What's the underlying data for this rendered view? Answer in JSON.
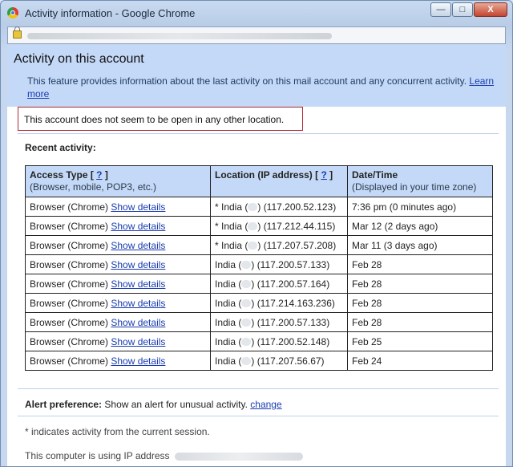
{
  "window": {
    "title": "Activity information - Google Chrome",
    "minimize": "—",
    "maximize": "□",
    "close": "X"
  },
  "header": {
    "title": "Activity on this account",
    "description": "This feature provides information about the last activity on this mail account and any concurrent activity.",
    "learn_more": "Learn more"
  },
  "notice": "This account does not seem to be open in any other location.",
  "recent_label": "Recent activity:",
  "table": {
    "headers": {
      "access_type": "Access Type",
      "access_sub": "(Browser, mobile, POP3, etc.)",
      "location": "Location (IP address)",
      "help": "?",
      "datetime": "Date/Time",
      "datetime_sub": "(Displayed in your time zone)"
    },
    "rows": [
      {
        "access": "Browser (Chrome)",
        "details": "Show details",
        "loc_pre": "* India (",
        "loc_post": ") (117.200.52.123)",
        "time": "7:36 pm (0 minutes ago)"
      },
      {
        "access": "Browser (Chrome)",
        "details": "Show details",
        "loc_pre": "* India (",
        "loc_post": ") (117.212.44.115)",
        "time": "Mar 12 (2 days ago)"
      },
      {
        "access": "Browser (Chrome)",
        "details": "Show details",
        "loc_pre": "* India (",
        "loc_post": ") (117.207.57.208)",
        "time": "Mar 11 (3 days ago)"
      },
      {
        "access": "Browser (Chrome)",
        "details": "Show details",
        "loc_pre": "India (",
        "loc_post": ") (117.200.57.133)",
        "time": "Feb 28"
      },
      {
        "access": "Browser (Chrome)",
        "details": "Show details",
        "loc_pre": "India (",
        "loc_post": ") (117.200.57.164)",
        "time": "Feb 28"
      },
      {
        "access": "Browser (Chrome)",
        "details": "Show details",
        "loc_pre": "India (",
        "loc_post": ") (117.214.163.236)",
        "time": "Feb 28"
      },
      {
        "access": "Browser (Chrome)",
        "details": "Show details",
        "loc_pre": "India (",
        "loc_post": ") (117.200.57.133)",
        "time": "Feb 28"
      },
      {
        "access": "Browser (Chrome)",
        "details": "Show details",
        "loc_pre": "India (",
        "loc_post": ") (117.200.52.148)",
        "time": "Feb 25"
      },
      {
        "access": "Browser (Chrome)",
        "details": "Show details",
        "loc_pre": "India (",
        "loc_post": ") (117.207.56.67)",
        "time": "Feb 24"
      }
    ]
  },
  "alert": {
    "label": "Alert preference:",
    "text": "Show an alert for unusual activity.",
    "change": "change"
  },
  "footnote": "* indicates activity from the current session.",
  "ip_line": "This computer is using IP address"
}
